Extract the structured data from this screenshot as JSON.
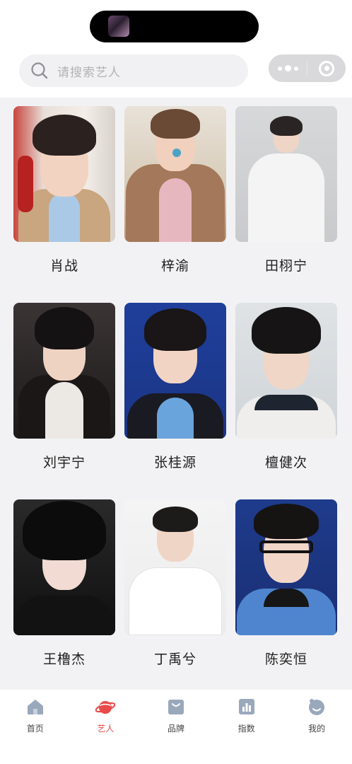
{
  "search": {
    "placeholder": "请搜索艺人"
  },
  "artists": [
    {
      "name": "肖战"
    },
    {
      "name": "梓渝"
    },
    {
      "name": "田栩宁"
    },
    {
      "name": "刘宇宁"
    },
    {
      "name": "张桂源"
    },
    {
      "name": "檀健次"
    },
    {
      "name": "王橹杰"
    },
    {
      "name": "丁禹兮"
    },
    {
      "name": "陈奕恒"
    }
  ],
  "tabbar": {
    "active": "artists",
    "items": [
      {
        "label": "首页",
        "icon": "home-icon"
      },
      {
        "label": "艺人",
        "icon": "planet-icon"
      },
      {
        "label": "品牌",
        "icon": "shopping-bag-icon"
      },
      {
        "label": "指数",
        "icon": "bar-chart-icon"
      },
      {
        "label": "我的",
        "icon": "profile-icon"
      }
    ]
  },
  "colors": {
    "accent": "#e84a4a",
    "tab_icon": "#9aa8bc",
    "background": "#f2f2f4"
  }
}
